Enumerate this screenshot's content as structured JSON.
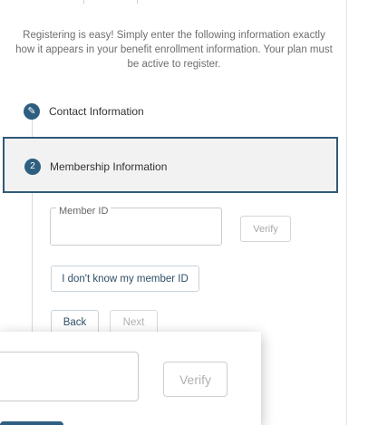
{
  "intro": {
    "text": "Registering is easy! Simply enter the following information exactly how it appears in your benefit enrollment information. Your plan must be active to register."
  },
  "steps": [
    {
      "label": "Contact Information",
      "icon": "pencil-icon",
      "state": "completed"
    },
    {
      "number": "2",
      "label": "Membership Information",
      "state": "active"
    }
  ],
  "member_id": {
    "label": "Member ID",
    "value": ""
  },
  "buttons": {
    "verify": "Verify",
    "dont_know": "I don't know my member ID",
    "back": "Back",
    "next": "Next"
  },
  "magnifier": {
    "verify": "Verify"
  },
  "colors": {
    "accent": "#2e5f80",
    "active_border": "#2f5a77",
    "panel_bg": "#f2f2f2"
  }
}
